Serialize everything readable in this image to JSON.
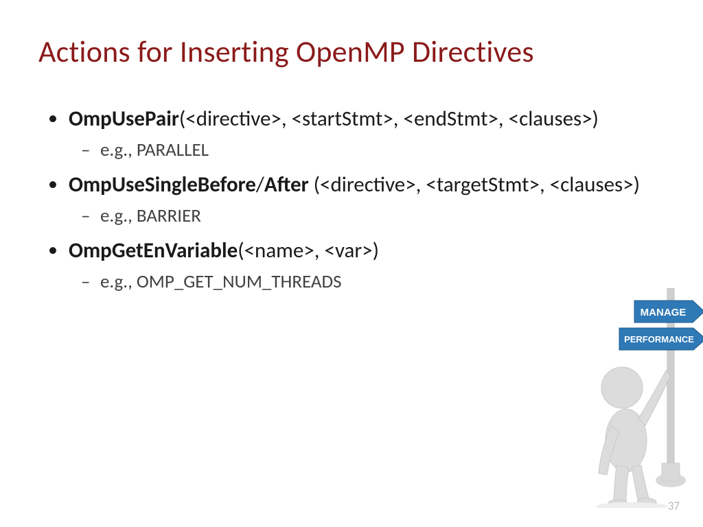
{
  "title": "Actions for Inserting OpenMP Directives",
  "bullets": [
    {
      "bold": "OmpUsePair",
      "rest": "(<directive>, <startStmt>, <endStmt>, <clauses>)",
      "sub": "e.g., PARALLEL"
    },
    {
      "bold": "OmpUseSingleBefore",
      "sep": "/",
      "bold2": "After",
      "rest": " (<directive>, <targetStmt>, <clauses>)",
      "sub": "e.g., BARRIER"
    },
    {
      "bold": "OmpGetEnVariable",
      "rest": "(<name>, <var>)",
      "sub": "e.g., OMP_GET_NUM_THREADS"
    }
  ],
  "signs": {
    "top": "MANAGE",
    "bottom": "PERFORMANCE"
  },
  "page": "37"
}
